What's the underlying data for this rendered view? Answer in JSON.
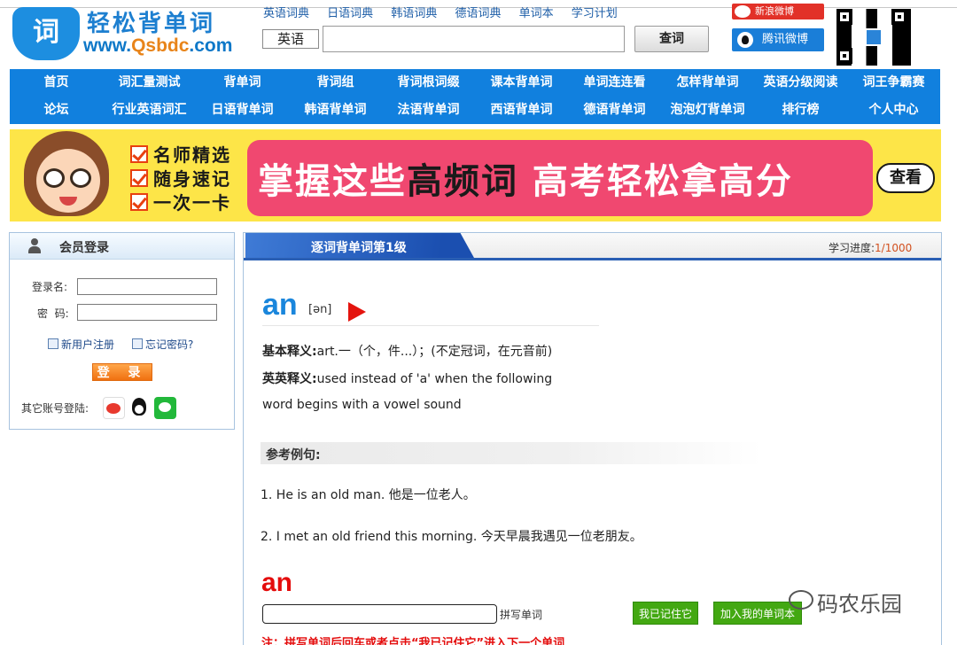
{
  "logo": {
    "badge": "词",
    "title": "轻松背单词",
    "url_prefix": "www.",
    "url_brand": "Qsbdc",
    "url_suffix": ".com"
  },
  "header": {
    "dict_links": [
      "英语词典",
      "日语词典",
      "韩语词典",
      "德语词典",
      "单词本",
      "学习计划"
    ],
    "language_select": "英语",
    "search_value": "",
    "search_button": "查词",
    "weibo_sina": "新浪微博",
    "weibo_tencent": "腾讯微博"
  },
  "nav": {
    "row1": [
      "首页",
      "词汇量测试",
      "背单词",
      "背词组",
      "背词根词缀",
      "课本背单词",
      "单词连连看",
      "怎样背单词",
      "英语分级阅读",
      "词王争霸赛"
    ],
    "row2": [
      "论坛",
      "行业英语词汇",
      "日语背单词",
      "韩语背单词",
      "法语背单词",
      "西语背单词",
      "德语背单词",
      "泡泡灯背单词",
      "排行榜",
      "个人中心"
    ]
  },
  "banner": {
    "checks": [
      "名师精选",
      "随身速记",
      "一次一卡"
    ],
    "text_1": "掌握这些",
    "text_2": "高频词",
    "text_3": " 高考轻松拿高分",
    "more": "查看"
  },
  "login": {
    "title": "会员登录",
    "username_label": "登录名:",
    "password_label": "密  码:",
    "register": "新用户注册",
    "forgot": "忘记密码?",
    "submit": "登 录",
    "other_accounts": "其它账号登陆:"
  },
  "main": {
    "tab_title": "逐词背单词第1级",
    "progress_label": "学习进度:",
    "progress_value": "1/1000",
    "word": "an",
    "phonetic": "[ən]",
    "basic_label": "基本释义:",
    "basic_def": "art.一（个，件...）；(不定冠词，在元音前)",
    "en_label": "英英释义:",
    "en_def_line1": "used instead of 'a' when the following",
    "en_def_line2": "word begins with a vowel sound",
    "examples_title": "参考例句:",
    "examples": [
      "1. He is an old man. 他是一位老人。",
      "2. I met an old friend this morning. 今天早晨我遇见一位老朋友。"
    ],
    "spell_word": "an",
    "spell_value": "",
    "spell_hint": "拼写单词",
    "remember_button": "我已记住它",
    "add_button": "加入我的单词本",
    "note": "注：拼写单词后回车或者点击“我已记住它”进入下一个单词"
  },
  "watermark": "码农乐园",
  "colors": {
    "nav_blue": "#1180de",
    "banner_yellow": "#fde548",
    "banner_pink": "#f04870",
    "word_blue": "#1a86dc",
    "spell_red": "#e40c0c",
    "button_green": "#43a812"
  }
}
